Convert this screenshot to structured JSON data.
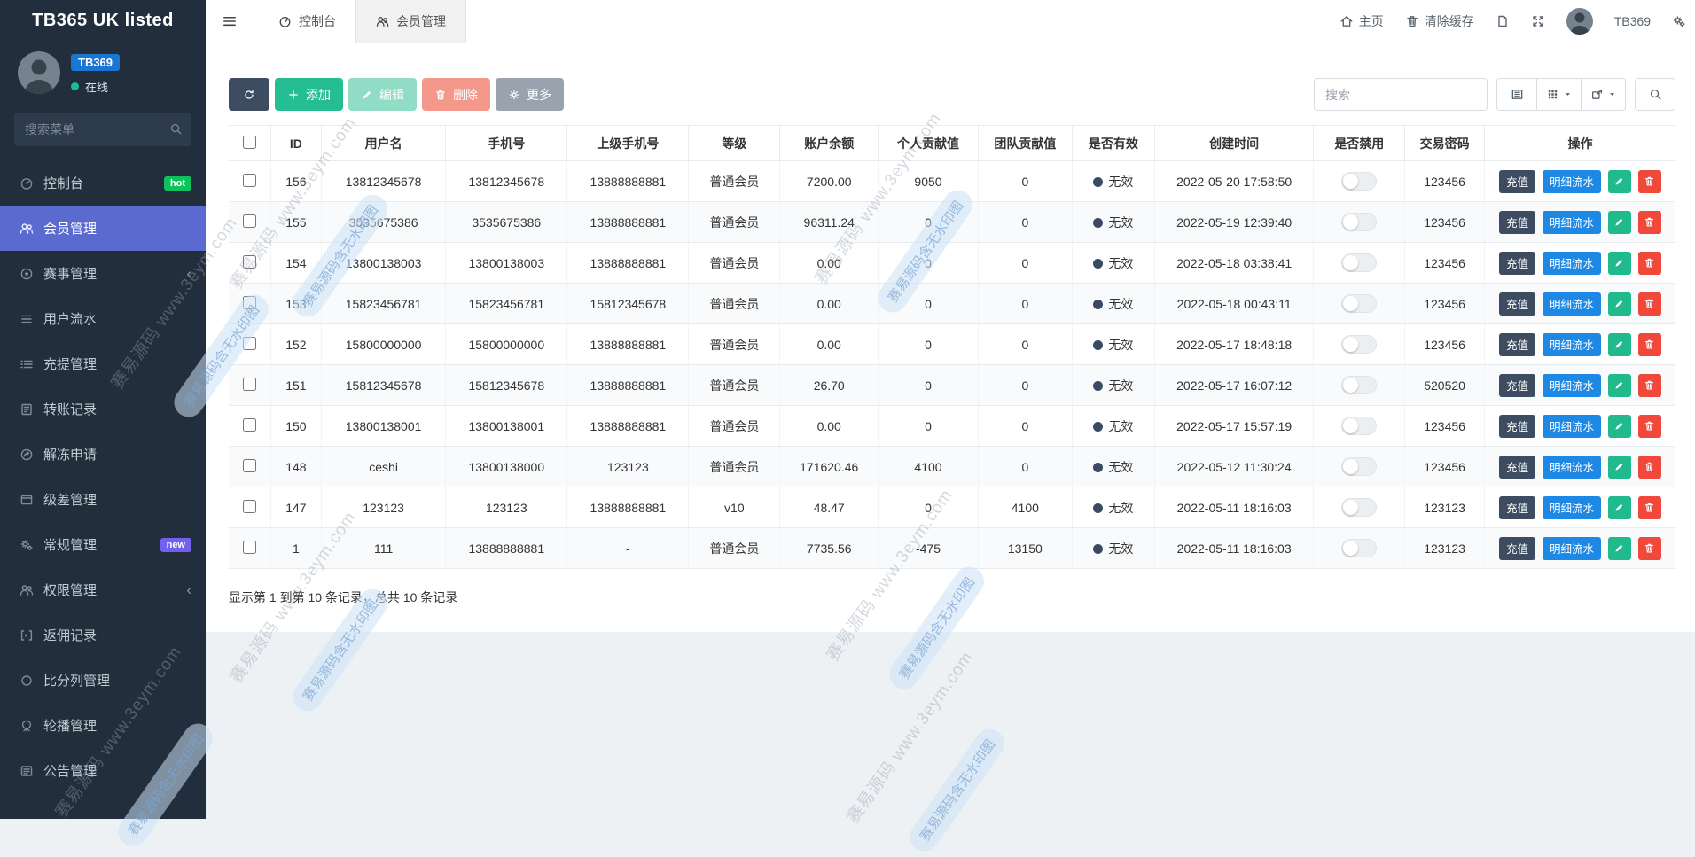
{
  "app": {
    "brand": "TB365 UK listed"
  },
  "sidebar": {
    "user": {
      "name": "TB369",
      "status": "在线"
    },
    "search_placeholder": "搜索菜单",
    "items": [
      {
        "label": "控制台",
        "icon": "dashboard-icon",
        "badge": "hot"
      },
      {
        "label": "会员管理",
        "icon": "users-icon",
        "active": true
      },
      {
        "label": "赛事管理",
        "icon": "futbol-icon",
        "chevron": true
      },
      {
        "label": "用户流水",
        "icon": "list-icon"
      },
      {
        "label": "充提管理",
        "icon": "list-alt-icon"
      },
      {
        "label": "转账记录",
        "icon": "record-icon"
      },
      {
        "label": "解冻申请",
        "icon": "share-icon"
      },
      {
        "label": "级差管理",
        "icon": "window-icon"
      },
      {
        "label": "常规管理",
        "icon": "cogs-icon",
        "badge": "new"
      },
      {
        "label": "权限管理",
        "icon": "users-icon",
        "chevron": true
      },
      {
        "label": "返佣记录",
        "icon": "bracket-icon"
      },
      {
        "label": "比分列管理",
        "icon": "circle-icon"
      },
      {
        "label": "轮播管理",
        "icon": "carousel-icon"
      },
      {
        "label": "公告管理",
        "icon": "notice-icon"
      }
    ]
  },
  "topbar": {
    "tabs": [
      {
        "label": "控制台",
        "icon": "dashboard-icon"
      },
      {
        "label": "会员管理",
        "icon": "users-icon",
        "active": true
      }
    ],
    "home": "主页",
    "clear_cache": "清除缓存",
    "user": "TB369"
  },
  "toolbar": {
    "add": "添加",
    "edit": "编辑",
    "delete": "删除",
    "more": "更多",
    "search_placeholder": "搜索"
  },
  "table": {
    "headers": [
      "ID",
      "用户名",
      "手机号",
      "上级手机号",
      "等级",
      "账户余额",
      "个人贡献值",
      "团队贡献值",
      "是否有效",
      "创建时间",
      "是否禁用",
      "交易密码",
      "操作"
    ],
    "action_labels": {
      "recharge": "充值",
      "detail": "明细流水"
    },
    "rows": [
      {
        "id": "156",
        "username": "13812345678",
        "phone": "13812345678",
        "parent_phone": "13888888881",
        "level": "普通会员",
        "balance": "7200.00",
        "personal": "9050",
        "team": "0",
        "valid": "无效",
        "created": "2022-05-20 17:58:50",
        "password": "123456"
      },
      {
        "id": "155",
        "username": "3535675386",
        "phone": "3535675386",
        "parent_phone": "13888888881",
        "level": "普通会员",
        "balance": "96311.24",
        "personal": "0",
        "team": "0",
        "valid": "无效",
        "created": "2022-05-19 12:39:40",
        "password": "123456"
      },
      {
        "id": "154",
        "username": "13800138003",
        "phone": "13800138003",
        "parent_phone": "13888888881",
        "level": "普通会员",
        "balance": "0.00",
        "personal": "0",
        "team": "0",
        "valid": "无效",
        "created": "2022-05-18 03:38:41",
        "password": "123456"
      },
      {
        "id": "153",
        "username": "15823456781",
        "phone": "15823456781",
        "parent_phone": "15812345678",
        "level": "普通会员",
        "balance": "0.00",
        "personal": "0",
        "team": "0",
        "valid": "无效",
        "created": "2022-05-18 00:43:11",
        "password": "123456"
      },
      {
        "id": "152",
        "username": "15800000000",
        "phone": "15800000000",
        "parent_phone": "13888888881",
        "level": "普通会员",
        "balance": "0.00",
        "personal": "0",
        "team": "0",
        "valid": "无效",
        "created": "2022-05-17 18:48:18",
        "password": "123456"
      },
      {
        "id": "151",
        "username": "15812345678",
        "phone": "15812345678",
        "parent_phone": "13888888881",
        "level": "普通会员",
        "balance": "26.70",
        "personal": "0",
        "team": "0",
        "valid": "无效",
        "created": "2022-05-17 16:07:12",
        "password": "520520"
      },
      {
        "id": "150",
        "username": "13800138001",
        "phone": "13800138001",
        "parent_phone": "13888888881",
        "level": "普通会员",
        "balance": "0.00",
        "personal": "0",
        "team": "0",
        "valid": "无效",
        "created": "2022-05-17 15:57:19",
        "password": "123456"
      },
      {
        "id": "148",
        "username": "ceshi",
        "phone": "13800138000",
        "parent_phone": "123123",
        "level": "普通会员",
        "balance": "171620.46",
        "personal": "4100",
        "team": "0",
        "valid": "无效",
        "created": "2022-05-12 11:30:24",
        "password": "123456"
      },
      {
        "id": "147",
        "username": "123123",
        "phone": "123123",
        "parent_phone": "13888888881",
        "level": "v10",
        "balance": "48.47",
        "personal": "0",
        "team": "4100",
        "valid": "无效",
        "created": "2022-05-11 18:16:03",
        "password": "123123"
      },
      {
        "id": "1",
        "username": "111",
        "phone": "13888888881",
        "parent_phone": "-",
        "level": "普通会员",
        "balance": "7735.56",
        "personal": "-475",
        "team": "13150",
        "valid": "无效",
        "created": "2022-05-11 18:16:03",
        "password": "123123"
      }
    ],
    "summary": "显示第 1 到第 10 条记录，总共 10 条记录"
  },
  "watermark": {
    "text": "赛易源码 www.3eym.com",
    "pill": "赛易源码含无水印图"
  },
  "colors": {
    "sidebar_bg": "#232e3c",
    "active_item": "#5a6acf",
    "hot_badge": "#0ec15d",
    "new_badge": "#7460ee",
    "online_dot": "#19bc9c",
    "badge_user": "#1976d2",
    "btn_dark": "#3e4c61",
    "btn_green": "#25bd92",
    "btn_green_light": "#90dcc4",
    "btn_red_light": "#f5988c",
    "btn_gray": "#99a3ad",
    "btn_blue": "#1e88e5",
    "btn_edit_green": "#21ba8d",
    "btn_del_red": "#f0483a",
    "invalid_dot": "#3a4a63",
    "content_bg": "#edf1f4"
  }
}
